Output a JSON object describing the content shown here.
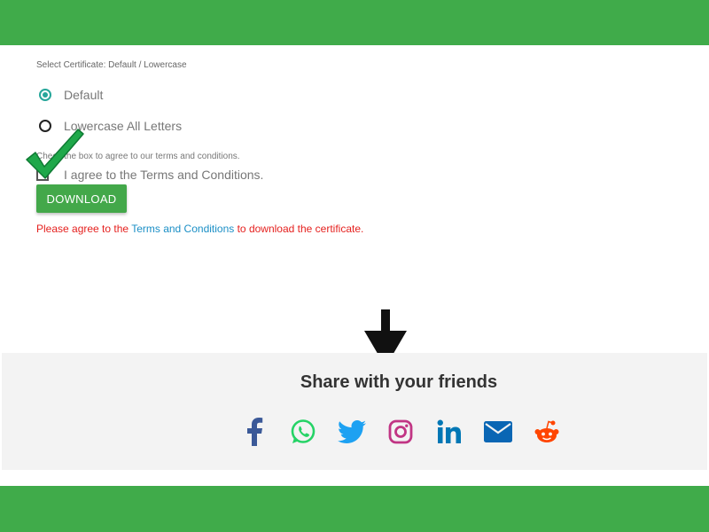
{
  "certificate_select": {
    "label": "Select Certificate: Default / Lowercase",
    "options": [
      {
        "label": "Default",
        "selected": true
      },
      {
        "label": "Lowercase All Letters",
        "selected": false
      }
    ]
  },
  "terms": {
    "hint": "Check the box to agree to our terms and conditions.",
    "checkbox_label": "I agree to the Terms and Conditions.",
    "checked": false
  },
  "download_button": {
    "label": "DOWNLOAD"
  },
  "error_message": {
    "before": "Please agree to the ",
    "link": "Terms and Conditions",
    "after": " to download the certificate."
  },
  "share": {
    "title": "Share with your friends",
    "icons": [
      {
        "name": "facebook-icon",
        "color": "#3b5998"
      },
      {
        "name": "whatsapp-icon",
        "color": "#25d366"
      },
      {
        "name": "twitter-icon",
        "color": "#1da1f2"
      },
      {
        "name": "instagram-icon",
        "color": "#c13584"
      },
      {
        "name": "linkedin-icon",
        "color": "#0077b5"
      },
      {
        "name": "email-icon",
        "color": "#0a66b4"
      },
      {
        "name": "reddit-icon",
        "color": "#ff4500"
      }
    ]
  },
  "colors": {
    "header_footer": "#40ab4a",
    "accent": "#26a69a",
    "error": "#e5211f",
    "link": "#1b8fc6"
  }
}
